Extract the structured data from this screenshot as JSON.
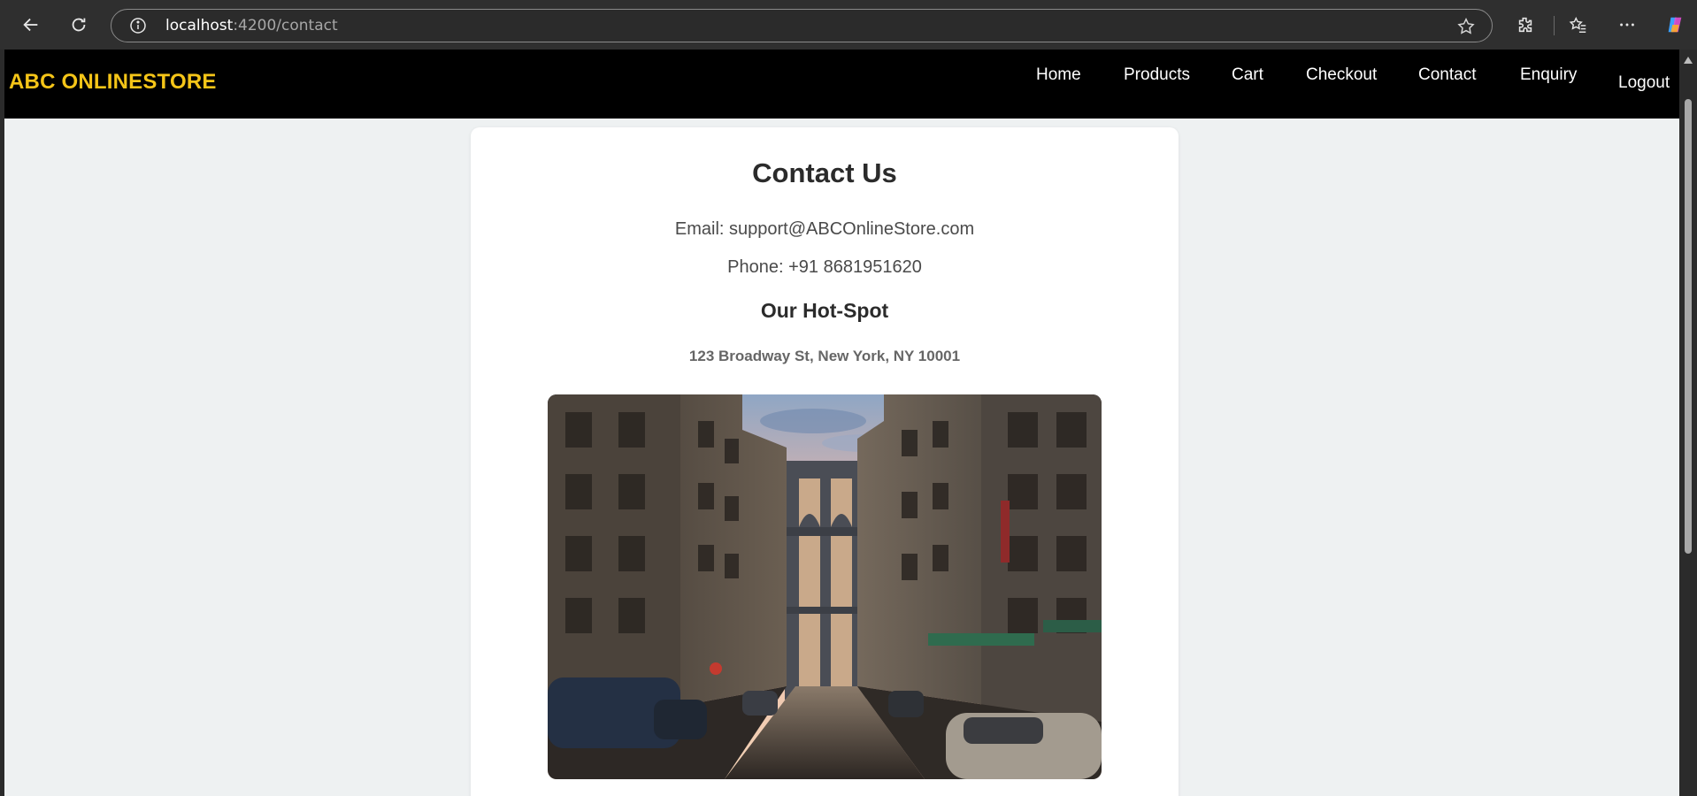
{
  "browser": {
    "url_host": "localhost",
    "url_path": ":4200/contact",
    "icons": [
      "back-arrow-icon",
      "reload-icon",
      "info-icon",
      "star-icon",
      "extensions-icon",
      "favorites-icon",
      "more-icon",
      "copilot-icon"
    ]
  },
  "navbar": {
    "brand": "ABC ONLINESTORE",
    "items": [
      {
        "label": "Home"
      },
      {
        "label": "Products"
      },
      {
        "label": "Cart"
      },
      {
        "label": "Checkout"
      },
      {
        "label": "Contact"
      },
      {
        "label": "Enquiry"
      },
      {
        "label": "Logout"
      }
    ],
    "colors": {
      "background": "#000000",
      "brand": "#f5c518",
      "link": "#ffffff"
    }
  },
  "contact": {
    "title": "Contact Us",
    "email_line": "Email: support@ABCOnlineStore.com",
    "phone_line": "Phone: +91 8681951620",
    "hotspot_title": "Our Hot-Spot",
    "address": "123 Broadway St, New York, NY 10001"
  },
  "colors": {
    "page_background": "#eef1f2",
    "card_background": "#ffffff"
  }
}
